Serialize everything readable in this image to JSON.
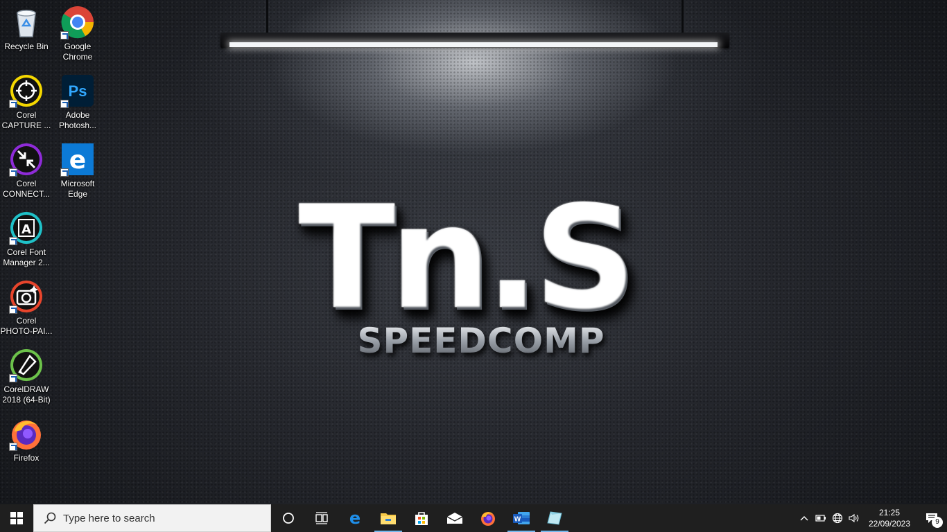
{
  "wallpaper": {
    "logo_main": "Tn.S",
    "logo_sub": "SPEEDCOMP"
  },
  "desktop_icons": [
    {
      "label": "Recycle Bin",
      "icon": "recycle-bin-icon"
    },
    {
      "label": "Google\nChrome",
      "icon": "chrome-icon"
    },
    {
      "label": "Corel\nCAPTURE ...",
      "icon": "corel-capture-icon"
    },
    {
      "label": "Adobe\nPhotosh...",
      "icon": "photoshop-icon"
    },
    {
      "label": "Corel\nCONNECT...",
      "icon": "corel-connect-icon"
    },
    {
      "label": "Microsoft\nEdge",
      "icon": "edge-icon"
    },
    {
      "label": "Corel Font\nManager 2...",
      "icon": "corel-font-manager-icon"
    },
    {
      "label": "Corel\nPHOTO-PAI...",
      "icon": "corel-photo-paint-icon"
    },
    {
      "label": "CorelDRAW\n2018 (64-Bit)",
      "icon": "coreldraw-icon"
    },
    {
      "label": "Firefox",
      "icon": "firefox-icon"
    }
  ],
  "taskbar": {
    "search_placeholder": "Type here to search",
    "pinned": [
      "start-icon",
      "cortana-icon",
      "task-view-icon",
      "edge-icon",
      "file-explorer-icon",
      "store-icon",
      "mail-icon",
      "firefox-icon",
      "word-icon",
      "notes-app-icon"
    ],
    "time": "21:25",
    "date": "22/09/2023",
    "notification_count": "9"
  },
  "colors": {
    "taskbar_bg": "#1f1f1f",
    "running_indicator": "#76b9ed",
    "edge_blue": "#0c7ad6"
  }
}
